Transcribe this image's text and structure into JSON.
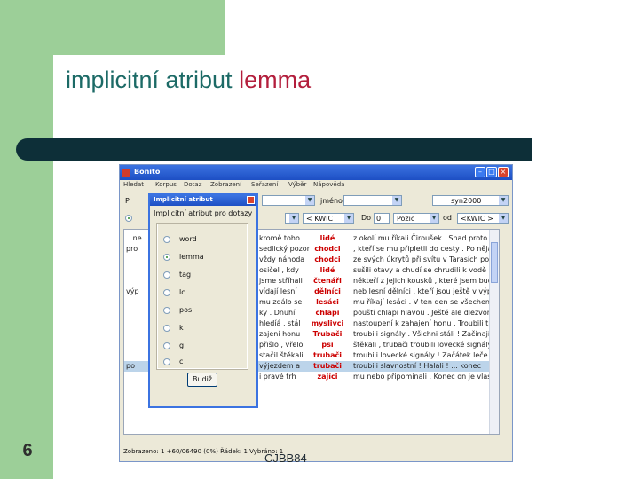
{
  "slide": {
    "title_prefix": "implicitní atribut ",
    "title_highlight": "lemma",
    "slide_number": "6",
    "footer": "CJBB84"
  },
  "app": {
    "window_title": "Bonito",
    "menu": [
      "Hledat",
      "Korpus",
      "Dotaz",
      "Zobrazení",
      "Seřazení",
      "Výběr",
      "Nápověda"
    ],
    "toolbar": {
      "label_p": "P",
      "label_jmeno": "jméno:",
      "corpus_value": "syn2000",
      "label_kwic": "< KWIC",
      "label_do": "Do",
      "do_value": "0",
      "label_pozic": "Pozic",
      "label_od": "od",
      "kwic_right": "<KWIC >"
    },
    "status": "Zobrazeno: 1 +60/06490 (0%)  Řádek: 1  Vybráno: 1"
  },
  "dialog": {
    "title": "Implicitní atribut",
    "heading": "Implicitní atribut pro dotazy",
    "options": [
      "word",
      "lemma",
      "tag",
      "lc",
      "pos",
      "k",
      "g",
      "c"
    ],
    "selected": "lemma",
    "ok_label": "Budiž"
  },
  "concordance": {
    "rows": [
      {
        "left": "...ne",
        "left_close": "kromě toho",
        "kwic": "lidé",
        "right": "z okolí mu říkali Čiroušek . Snad proto ."
      },
      {
        "left": "pro",
        "left_close": "sedlický pozor",
        "kwic": "chodci",
        "right": ", kteří se mu připletli do cesty . Po nějaké"
      },
      {
        "left": "",
        "left_close": "vždy náhoda",
        "kwic": "chodci",
        "right": "ze svých úkrytů při svítu v Tarasích po"
      },
      {
        "left": "",
        "left_close": "osičel , kdy",
        "kwic": "lidé",
        "right": "sušili otavy a chudí se chrudili k vodě"
      },
      {
        "left": "",
        "left_close": "jsme stříhali",
        "kwic": "čtenáři",
        "right": "někteří z jejich kousků , které jsem buď"
      },
      {
        "left": "výp",
        "left_close": "vídají lesní",
        "kwic": "dělníci",
        "right": "neb lesní dělníci , kteří jsou ještě v výpočtu"
      },
      {
        "left": "",
        "left_close": "mu zdálo se",
        "kwic": "lesáci",
        "right": "mu říkají lesáci . V ten den se všechen"
      },
      {
        "left": "",
        "left_close": "ky . Dnuhí",
        "kwic": "chlapi",
        "right": "pouští chlapi hlavou . Ještě ale dlezvon"
      },
      {
        "left": "",
        "left_close": "hledíá , stál",
        "kwic": "myslivci",
        "right": "nastoupení k zahajení honu . Troubili troub"
      },
      {
        "left": "",
        "left_close": "zajení honu",
        "kwic": "Trubači",
        "right": "troubili signály . Všichni stáli ! Začínají"
      },
      {
        "left": "",
        "left_close": "přišlo , vřelo",
        "kwic": "psi",
        "right": "štěkali , trubači troubili lovecké signály"
      },
      {
        "left": "",
        "left_close": "stačil štěkali",
        "kwic": "trubači",
        "right": "troubili lovecké signály ! Začátek leče"
      },
      {
        "left": "po",
        "left_close": "výjezdem a",
        "kwic": "trubači",
        "right": "troubili slavnostní ! Halali ! ... konec"
      },
      {
        "left": "",
        "left_close": "i pravé trh",
        "kwic": "zajíci",
        "right": "mu nebo připomínali . Konec on je vlastně"
      }
    ],
    "selected_row": 12
  },
  "colors": {
    "green": "#9ccf98",
    "title_teal": "#1c6a66",
    "title_red": "#b31e3c",
    "bar": "#0d2f38",
    "kwic_red": "#cc0000",
    "selection": "#bcd4ea"
  }
}
